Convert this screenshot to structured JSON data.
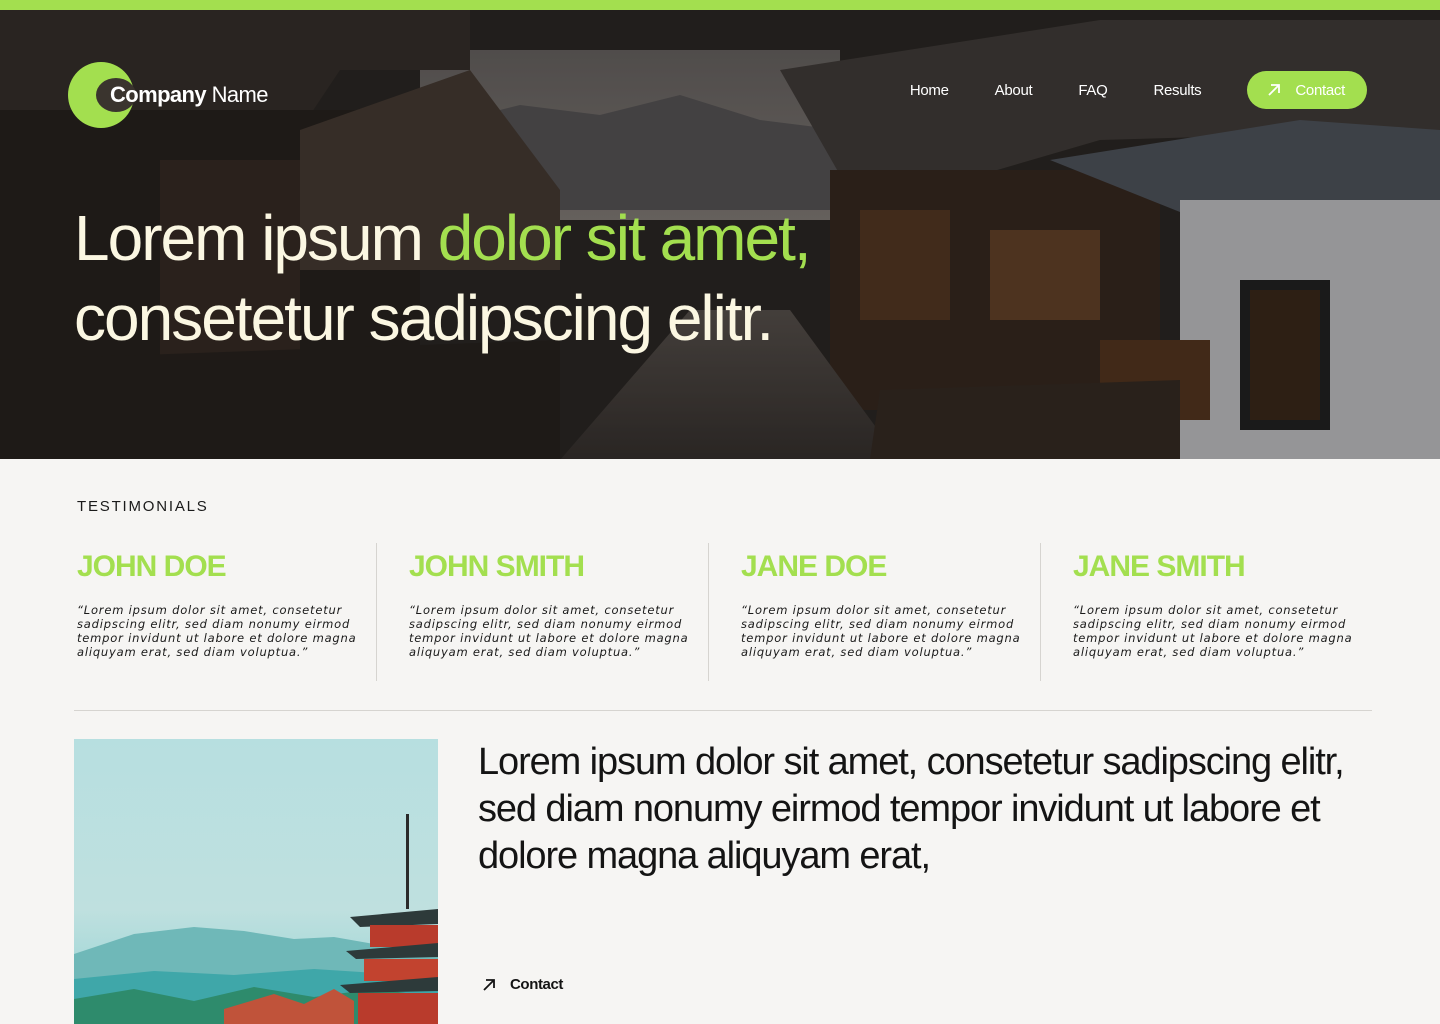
{
  "colors": {
    "accent": "#a3df4f",
    "hero_text": "#fbf7e2",
    "background": "#f6f5f3"
  },
  "logo": {
    "bold": "Company",
    "light": "Name"
  },
  "nav": {
    "items": [
      "Home",
      "About",
      "FAQ",
      "Results"
    ],
    "contact_label": "Contact",
    "contact_icon": "arrow-up-right-icon"
  },
  "hero": {
    "line1_plain": "Lorem ipsum ",
    "line1_accent": "dolor sit amet,",
    "line2": "consetetur sadipscing elitr."
  },
  "testimonials": {
    "label": "TESTIMONIALS",
    "items": [
      {
        "name": "JOHN DOE",
        "quote": "“Lorem ipsum dolor sit amet, consetetur sadipscing elitr, sed diam nonumy eirmod tempor invidunt ut labore et dolore magna aliquyam erat, sed diam voluptua.”"
      },
      {
        "name": "JOHN SMITH",
        "quote": "“Lorem ipsum dolor sit amet, consetetur sadipscing elitr, sed diam nonumy eirmod tempor invidunt ut labore et dolore magna aliquyam erat, sed diam voluptua.”"
      },
      {
        "name": "JANE DOE",
        "quote": "“Lorem ipsum dolor sit amet, consetetur sadipscing elitr, sed diam nonumy eirmod tempor invidunt ut labore et dolore magna aliquyam erat, sed diam voluptua.”"
      },
      {
        "name": "JANE SMITH",
        "quote": "“Lorem ipsum dolor sit amet, consetetur sadipscing elitr, sed diam nonumy eirmod tempor invidunt ut labore et dolore magna aliquyam erat, sed diam voluptua.”"
      }
    ]
  },
  "feature": {
    "text": "Lorem ipsum dolor sit amet, consetetur sadipscing elitr, sed diam nonumy eirmod tempor invidunt ut labore et dolore magna aliquyam erat,",
    "contact_label": "Contact",
    "contact_icon": "arrow-up-right-icon"
  }
}
